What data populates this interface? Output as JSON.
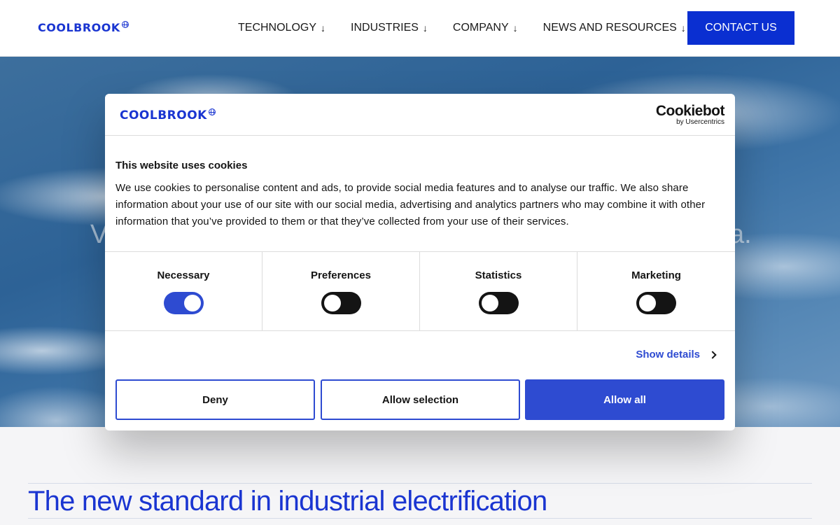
{
  "header": {
    "logo_text": "COOLBROOK",
    "nav": [
      {
        "label": "TECHNOLOGY",
        "arrow": "↓"
      },
      {
        "label": "INDUSTRIES",
        "arrow": "↓"
      },
      {
        "label": "COMPANY",
        "arrow": "↓"
      },
      {
        "label": "NEWS AND RESOURCES",
        "arrow": "↓"
      }
    ],
    "contact_label": "CONTACT US"
  },
  "hero": {
    "text_left_fragment": "V",
    "text_right_fragment": "a."
  },
  "content": {
    "headline": "The new standard in industrial electrification"
  },
  "cookie_dialog": {
    "logo_text": "COOLBROOK",
    "brand_main": "Cookiebot",
    "brand_sub": "by Usercentrics",
    "title": "This website uses cookies",
    "body": "We use cookies to personalise content and ads, to provide social media features and to analyse our traffic. We also share information about your use of our site with our social media, advertising and analytics partners who may combine it with other information that you’ve provided to them or that they’ve collected from your use of their services.",
    "categories": [
      {
        "label": "Necessary",
        "enabled": true
      },
      {
        "label": "Preferences",
        "enabled": false
      },
      {
        "label": "Statistics",
        "enabled": false
      },
      {
        "label": "Marketing",
        "enabled": false
      }
    ],
    "show_details_label": "Show details",
    "buttons": {
      "deny": "Deny",
      "allow_selection": "Allow selection",
      "allow_all": "Allow all"
    }
  },
  "colors": {
    "brand_blue": "#1a35d1",
    "contact_bg": "#0a2fd1",
    "cookie_accent": "#2e4bd1"
  }
}
